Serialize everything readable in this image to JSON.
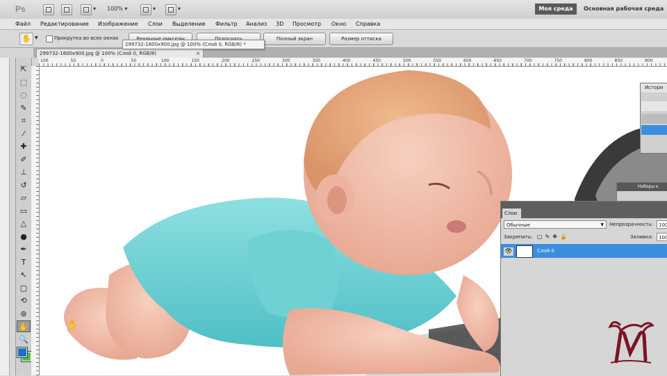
{
  "appbar": {
    "logo": "Ps",
    "zoom": "100%",
    "workspace_active": "Моя среда",
    "workspace_main": "Основная рабочая среда"
  },
  "menu": [
    "Файл",
    "Редактирование",
    "Изображение",
    "Слои",
    "Выделение",
    "Фильтр",
    "Анализ",
    "3D",
    "Просмотр",
    "Окно",
    "Справка"
  ],
  "options": {
    "scroll_all": "Прокрутка во всех окнах",
    "actual_pixels": "Реальные пикселы",
    "fit_screen": "Подогнать",
    "full_screen": "Полный экран",
    "print_size": "Размер оттиска"
  },
  "document": {
    "tab_title": "299732-1600x900.jpg @ 100% (Слой 0, RGB/8)",
    "tab_close": "×",
    "tooltip": "299732-1600x900.jpg @ 100% (Слой 0, RGB/8) *"
  },
  "ruler_ticks": [
    "100",
    "50",
    "0",
    "50",
    "100",
    "150",
    "200",
    "250",
    "300",
    "350",
    "400",
    "450",
    "500",
    "550",
    "600",
    "650",
    "700",
    "750",
    "800",
    "850",
    "900"
  ],
  "tools": [
    {
      "name": "move-tool-icon",
      "glyph": "⇱"
    },
    {
      "name": "marquee-tool-icon",
      "glyph": "⬚"
    },
    {
      "name": "lasso-tool-icon",
      "glyph": "◌"
    },
    {
      "name": "quick-select-tool-icon",
      "glyph": "✎"
    },
    {
      "name": "crop-tool-icon",
      "glyph": "⌗"
    },
    {
      "name": "eyedropper-tool-icon",
      "glyph": "⁄"
    },
    {
      "name": "healing-brush-tool-icon",
      "glyph": "✚"
    },
    {
      "name": "brush-tool-icon",
      "glyph": "✐"
    },
    {
      "name": "clone-stamp-tool-icon",
      "glyph": "⊥"
    },
    {
      "name": "history-brush-tool-icon",
      "glyph": "↺"
    },
    {
      "name": "eraser-tool-icon",
      "glyph": "▱"
    },
    {
      "name": "gradient-tool-icon",
      "glyph": "▭"
    },
    {
      "name": "blur-tool-icon",
      "glyph": "△"
    },
    {
      "name": "dodge-tool-icon",
      "glyph": "●"
    },
    {
      "name": "pen-tool-icon",
      "glyph": "✒"
    },
    {
      "name": "type-tool-icon",
      "glyph": "T"
    },
    {
      "name": "path-select-tool-icon",
      "glyph": "↖"
    },
    {
      "name": "shape-tool-icon",
      "glyph": "▢"
    },
    {
      "name": "3d-rotate-tool-icon",
      "glyph": "⟲"
    },
    {
      "name": "3d-orbit-tool-icon",
      "glyph": "⊚"
    },
    {
      "name": "hand-tool-icon",
      "glyph": "✋"
    },
    {
      "name": "zoom-tool-icon",
      "glyph": "🔍"
    }
  ],
  "colors": {
    "foreground": "#1d6fc4",
    "background": "#4ec43c",
    "layer_selected": "#3b8ee0",
    "watermark": "#7a1424"
  },
  "history_panel": {
    "title": "Истори"
  },
  "sets_panel": {
    "title": "Наборы к"
  },
  "layers_panel": {
    "tab": "Слои",
    "blend_mode": "Обычные",
    "opacity_label": "Непрозрачность:",
    "opacity_value": "100",
    "lock_label": "Закрепить:",
    "fill_label": "Заливка:",
    "fill_value": "100",
    "layer_name": "Слой 0"
  }
}
